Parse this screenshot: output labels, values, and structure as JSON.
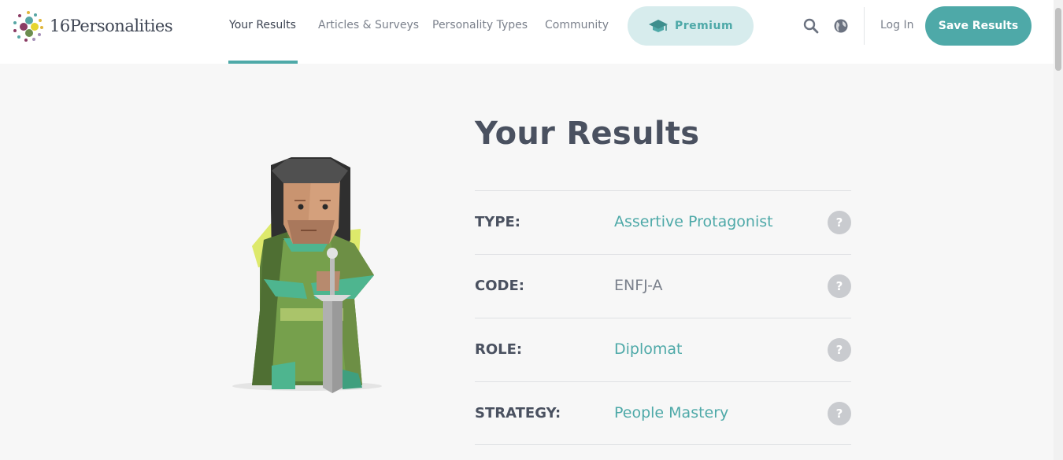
{
  "brand": {
    "name": "16Personalities"
  },
  "nav": {
    "items": [
      {
        "label": "Your Results",
        "active": true
      },
      {
        "label": "Articles & Surveys",
        "active": false
      },
      {
        "label": "Personality Types",
        "active": false
      },
      {
        "label": "Community",
        "active": false
      }
    ],
    "premium_label": "Premium",
    "login_label": "Log In",
    "save_label": "Save Results"
  },
  "icons": {
    "search": "search-icon",
    "language": "globe-icon",
    "premium": "graduation-cap-icon",
    "help": "question-mark-icon"
  },
  "colors": {
    "accent": "#4ea9a8",
    "premium_bg": "#d7eced",
    "text_dark": "#4a5160",
    "text_muted": "#7b818c"
  },
  "main": {
    "title": "Your Results",
    "results": [
      {
        "label": "TYPE:",
        "value": "Assertive Protagonist",
        "help": "?"
      },
      {
        "label": "CODE:",
        "value": "ENFJ-A",
        "help": "?"
      },
      {
        "label": "ROLE:",
        "value": "Diplomat",
        "help": "?"
      },
      {
        "label": "STRATEGY:",
        "value": "People Mastery",
        "help": "?"
      }
    ]
  }
}
